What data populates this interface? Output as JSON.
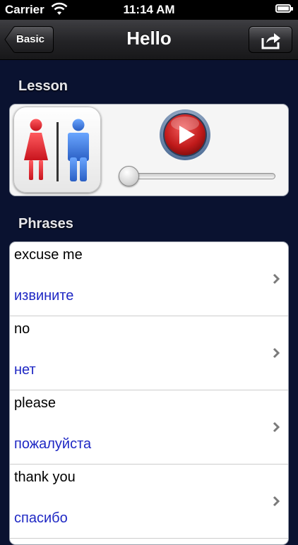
{
  "status_bar": {
    "carrier": "Carrier",
    "time": "11:14 AM"
  },
  "nav": {
    "back_label": "Basic",
    "title": "Hello",
    "share_icon": "share-icon"
  },
  "lesson": {
    "header": "Lesson",
    "icon": "restroom-icon",
    "progress": 0.0
  },
  "phrases": {
    "header": "Phrases",
    "items": [
      {
        "en": "excuse me",
        "ru": "извините"
      },
      {
        "en": "no",
        "ru": "нет"
      },
      {
        "en": "please",
        "ru": "пожалуйста"
      },
      {
        "en": "thank you",
        "ru": "спасибо"
      }
    ]
  },
  "colors": {
    "translation": "#1f28c4",
    "background": "#0a1230",
    "woman": "#e8323a",
    "man": "#3d7fe0"
  }
}
